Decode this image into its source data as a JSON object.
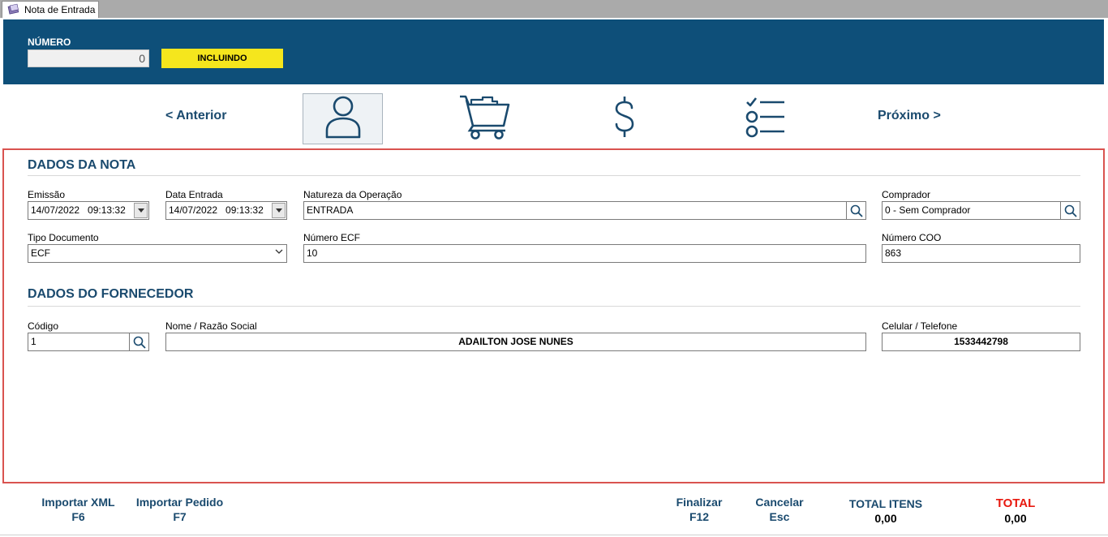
{
  "tab": {
    "label": "Nota de Entrada"
  },
  "header": {
    "number_label": "NÚMERO",
    "number_value": "0",
    "status": "INCLUINDO"
  },
  "nav": {
    "prev_label": "< Anterior",
    "next_label": "Próximo >",
    "steps": [
      {
        "icon": "user-icon",
        "active": true
      },
      {
        "icon": "cart-icon",
        "active": false
      },
      {
        "icon": "dollar-icon",
        "active": false
      },
      {
        "icon": "checklist-icon",
        "active": false
      }
    ]
  },
  "nota": {
    "title": "DADOS DA NOTA",
    "emissao": {
      "label": "Emissão",
      "value": "14/07/2022   09:13:32"
    },
    "data_entrada": {
      "label": "Data Entrada",
      "value": "14/07/2022   09:13:32"
    },
    "natureza": {
      "label": "Natureza da Operação",
      "value": "ENTRADA"
    },
    "comprador": {
      "label": "Comprador",
      "value": "0 - Sem Comprador"
    },
    "tipo_documento": {
      "label": "Tipo Documento",
      "value": "ECF"
    },
    "numero_ecf": {
      "label": "Número ECF",
      "value": "10"
    },
    "numero_coo": {
      "label": "Número COO",
      "value": "863"
    }
  },
  "fornecedor": {
    "title": "DADOS DO FORNECEDOR",
    "codigo": {
      "label": "Código",
      "value": "1"
    },
    "nome": {
      "label": "Nome / Razão Social",
      "value": "ADAILTON JOSE NUNES"
    },
    "telefone": {
      "label": "Celular / Telefone",
      "value": "1533442798"
    }
  },
  "footer": {
    "importar_xml": {
      "line1": "Importar XML",
      "line2": "F6"
    },
    "importar_pedido": {
      "line1": "Importar Pedido",
      "line2": "F7"
    },
    "finalizar": {
      "line1": "Finalizar",
      "line2": "F12"
    },
    "cancelar": {
      "line1": "Cancelar",
      "line2": "Esc"
    },
    "total_itens": {
      "label": "TOTAL ITENS",
      "value": "0,00"
    },
    "total": {
      "label": "TOTAL",
      "value": "0,00"
    }
  },
  "colors": {
    "header_bg": "#0e4f79",
    "status_bg": "#f5e61d",
    "accent_text": "#1a4a6e",
    "panel_border": "#d9534f",
    "total_red": "#e8190f"
  }
}
